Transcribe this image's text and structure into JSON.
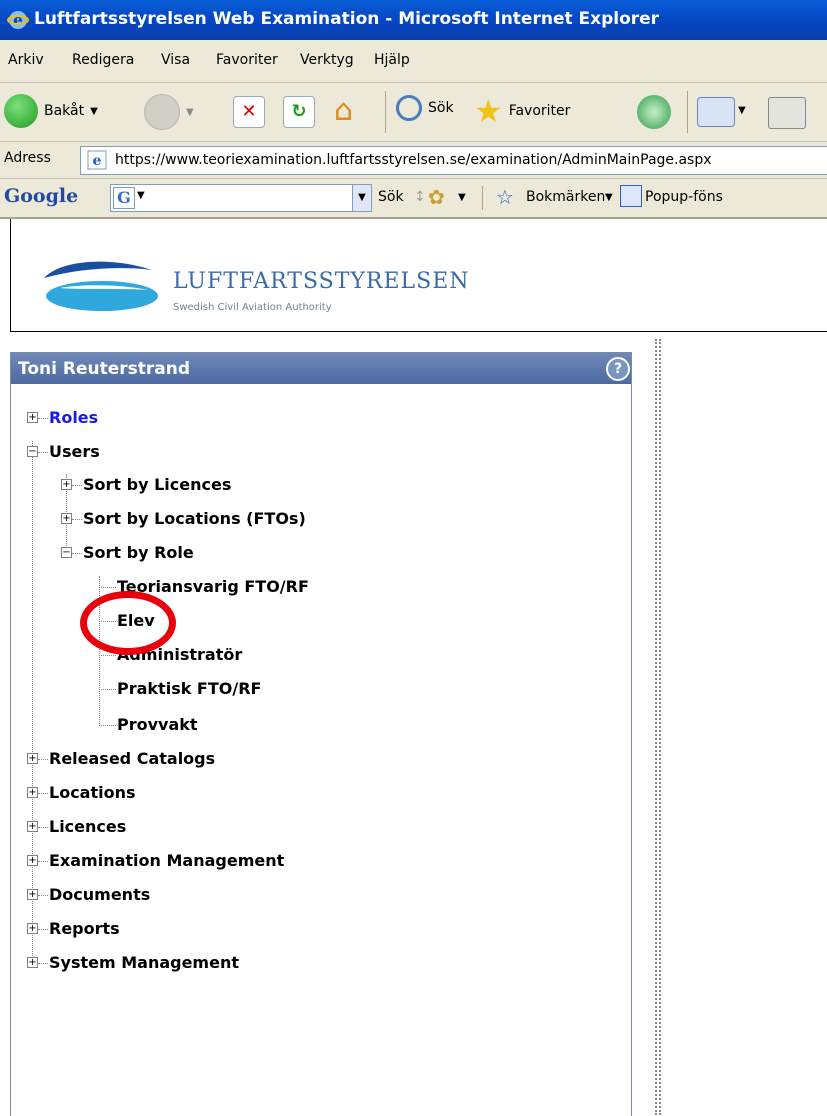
{
  "window": {
    "title": "Luftfartsstyrelsen Web Examination - Microsoft Internet Explorer"
  },
  "menu": [
    "Arkiv",
    "Redigera",
    "Visa",
    "Favoriter",
    "Verktyg",
    "Hjälp"
  ],
  "toolbar": {
    "back": "Bakåt",
    "search": "Sök",
    "favorites": "Favoriter"
  },
  "address": {
    "label": "Adress",
    "url": "https://www.teoriexamination.luftfartsstyrelsen.se/examination/AdminMainPage.aspx"
  },
  "google": {
    "logo": "Google",
    "box_glyph": "G",
    "search": "Sök",
    "bookmarks": "Bokmärken",
    "popup": "Popup-föns"
  },
  "brand": {
    "name": "LUFTFARTSSTYRELSEN",
    "subtitle": "Swedish Civil Aviation Authority"
  },
  "panel": {
    "user": "Toni Reuterstrand",
    "help_glyph": "?"
  },
  "tree": {
    "roles": "Roles",
    "users": "Users",
    "sort_licences": "Sort by Licences",
    "sort_locations": "Sort by Locations (FTOs)",
    "sort_role": "Sort by Role",
    "role_teori": "Teoriansvarig FTO/RF",
    "role_elev": "Elev",
    "role_admin": "Administratör",
    "role_praktisk": "Praktisk FTO/RF",
    "role_provvakt": "Provvakt",
    "released": "Released Catalogs",
    "locations": "Locations",
    "licences": "Licences",
    "exam_mgmt": "Examination Management",
    "documents": "Documents",
    "reports": "Reports",
    "system_mgmt": "System Management"
  },
  "colors": {
    "titlebar": "#0548c4",
    "panel_header": "#5a76ab",
    "link": "#1a1ae6",
    "annotation_ring": "#e8000d"
  }
}
